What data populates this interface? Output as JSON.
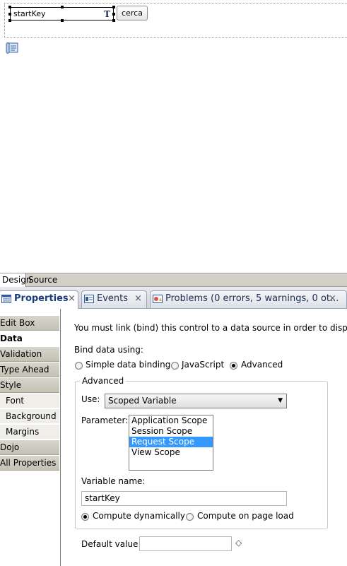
{
  "canvas": {
    "editbox_value": "startKey",
    "editbox_type_icon": "T",
    "button_label": "cerca"
  },
  "mode_tabs": [
    "Design",
    "Source"
  ],
  "view_tabs": {
    "properties": "Properties",
    "events": "Events",
    "problems": "Problems (0 errors, 5 warnings, 0 ot...",
    "close_glyph": "×"
  },
  "nav": {
    "items": [
      {
        "label": "Edit Box",
        "kind": "cat"
      },
      {
        "label": "Data",
        "kind": "sel"
      },
      {
        "label": "Validation",
        "kind": "cat"
      },
      {
        "label": "Type Ahead",
        "kind": "cat"
      },
      {
        "label": "Style",
        "kind": "cat"
      },
      {
        "label": "Font",
        "kind": "sub"
      },
      {
        "label": "Background",
        "kind": "sub"
      },
      {
        "label": "Margins",
        "kind": "sub"
      },
      {
        "label": "Dojo",
        "kind": "cat"
      },
      {
        "label": "All Properties",
        "kind": "cat"
      }
    ]
  },
  "data_page": {
    "info": "You must link (bind) this control to a data source in order to display or sto",
    "bind_label": "Bind data using:",
    "bind_options": {
      "simple": "Simple data binding",
      "javascript": "JavaScript",
      "advanced": "Advanced"
    },
    "bind_selected": "advanced",
    "advanced_group": "Advanced",
    "use_label": "Use:",
    "use_value": "Scoped Variable",
    "parameter_label": "Parameter:",
    "parameters": [
      "Application Scope",
      "Session Scope",
      "Request Scope",
      "View Scope"
    ],
    "parameter_selected": "Request Scope",
    "variable_name_label": "Variable name:",
    "variable_name_value": "startKey",
    "compute_options": {
      "dynamic": "Compute dynamically",
      "onload": "Compute on page load"
    },
    "compute_selected": "dynamic",
    "default_value_label": "Default value:",
    "default_value": ""
  },
  "icons": {
    "diamond": "◇",
    "dropdown_arrow": "▼"
  }
}
